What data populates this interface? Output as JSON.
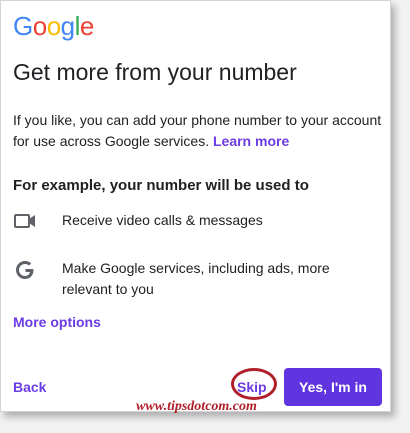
{
  "brand": {
    "letters": [
      {
        "ch": "G",
        "color": "#4285F4"
      },
      {
        "ch": "o",
        "color": "#EA4335"
      },
      {
        "ch": "o",
        "color": "#FBBC05"
      },
      {
        "ch": "g",
        "color": "#4285F4"
      },
      {
        "ch": "l",
        "color": "#34A853"
      },
      {
        "ch": "e",
        "color": "#EA4335"
      }
    ]
  },
  "page": {
    "title": "Get more from your number",
    "intro": "If you like, you can add your phone number to your account for use across Google services.",
    "learn_more": "Learn more",
    "subhead": "For example, your number will be used to"
  },
  "features": [
    {
      "icon": "video-camera-icon",
      "text": "Receive video calls & messages"
    },
    {
      "icon": "google-g-icon",
      "text": "Make Google services, including ads, more relevant to you"
    }
  ],
  "actions": {
    "more_options": "More options",
    "back": "Back",
    "skip": "Skip",
    "yes": "Yes, I'm in"
  },
  "watermark": "www.tipsdotcom.com",
  "colors": {
    "accent": "#5f35e0",
    "link": "#6c3ce3",
    "annotation": "#b0202a"
  }
}
